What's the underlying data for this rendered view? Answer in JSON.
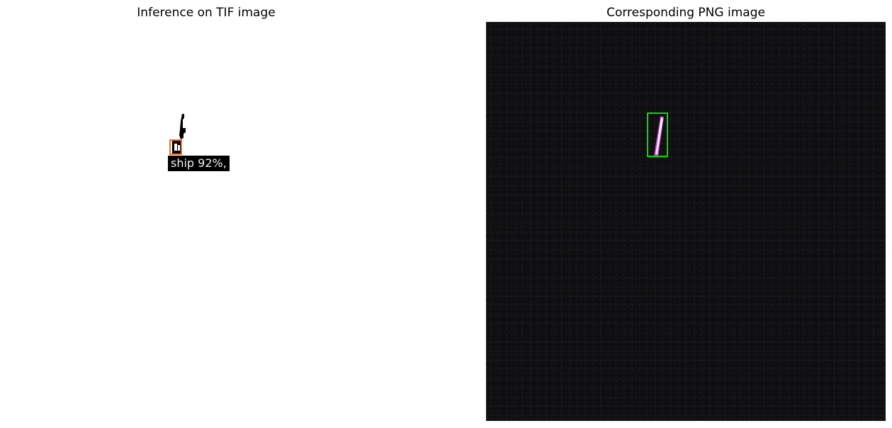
{
  "panels": {
    "left": {
      "title": "Inference on TIF image",
      "detection": {
        "label": "ship 92%,",
        "box_color": "#f26b2a"
      }
    },
    "right": {
      "title": "Corresponding PNG image",
      "detection": {
        "box_color": "#00e000"
      }
    }
  }
}
